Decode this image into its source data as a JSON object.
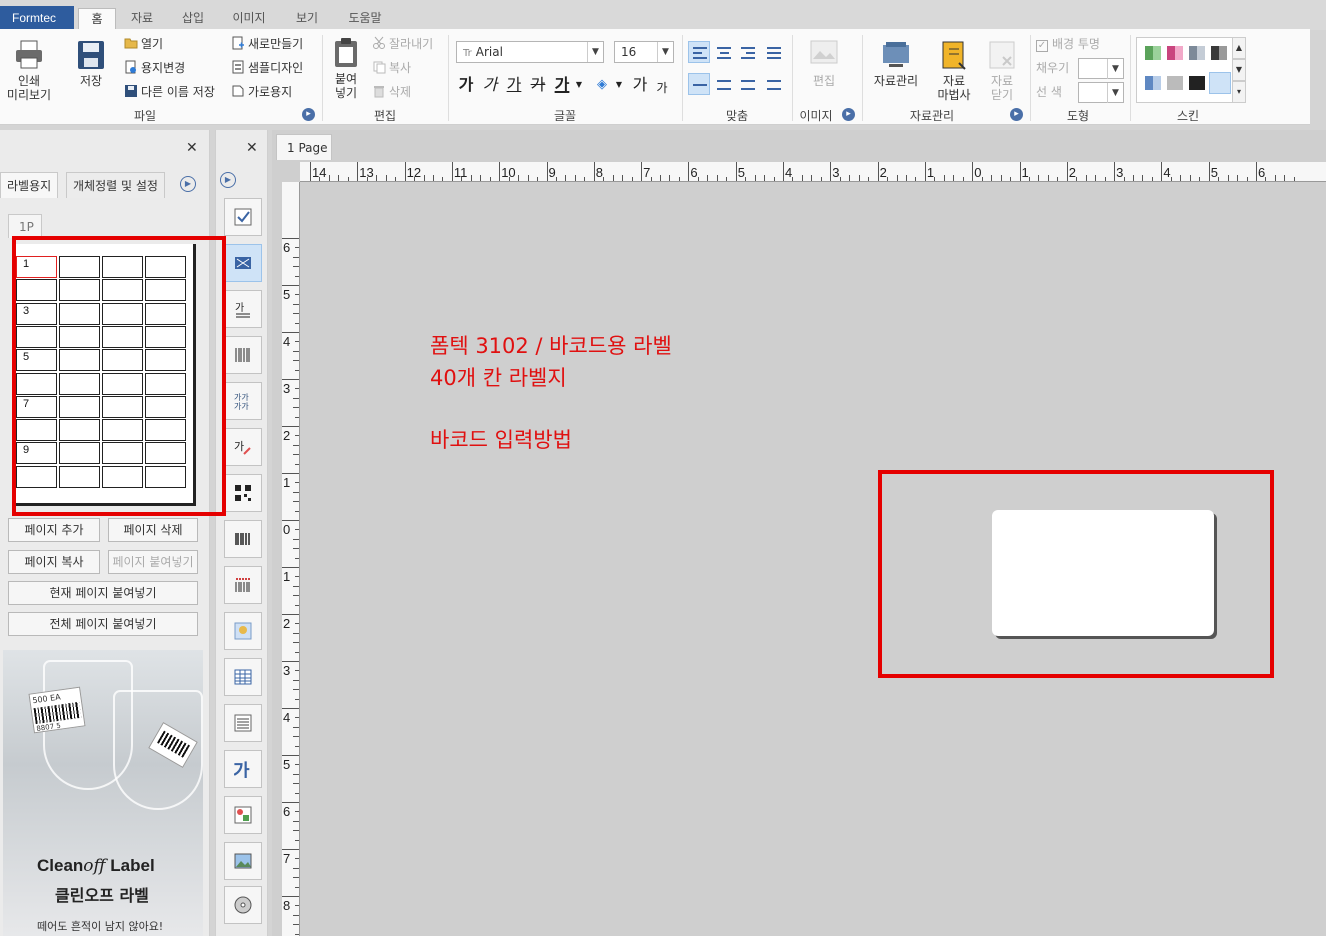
{
  "app": {
    "title": "Formtec"
  },
  "menu": {
    "tabs": [
      "홈",
      "자료",
      "삽입",
      "이미지",
      "보기",
      "도움말"
    ],
    "active": "홈"
  },
  "ribbon": {
    "file": {
      "print_preview": "인쇄\n미리보기",
      "save": "저장",
      "open": "열기",
      "change_paper": "용지변경",
      "save_as": "다른 이름 저장",
      "new": "새로만들기",
      "sample_design": "샘플디자인",
      "landscape": "가로용지",
      "group_label": "파일"
    },
    "edit": {
      "paste": "붙여\n넣기",
      "cut": "잘라내기",
      "copy": "복사",
      "delete": "삭제",
      "group_label": "편집"
    },
    "font": {
      "font_name": "Arial",
      "font_size": "16",
      "bold": "가",
      "italic": "가",
      "underline": "가",
      "strike": "가",
      "color": "가",
      "grow": "가",
      "shrink": "가",
      "group_label": "글꼴"
    },
    "align": {
      "group_label": "맞춤"
    },
    "image": {
      "edit": "편집",
      "group_label": "이미지"
    },
    "data": {
      "manage": "자료관리",
      "wizard": "자료\n마법사",
      "close": "자료\n닫기",
      "group_label": "자료관리"
    },
    "shape": {
      "transparent": "배경 투명",
      "fill": "채우기",
      "line_color": "선    색",
      "group_label": "도형"
    },
    "skin": {
      "group_label": "스킨"
    }
  },
  "left_panel": {
    "tabs": [
      "라벨용지",
      "개체정렬 및 설정"
    ],
    "active_tab": "라벨용지",
    "page_chip": "1P",
    "cell_numbers": [
      "1",
      "3",
      "5",
      "7",
      "9"
    ],
    "buttons": {
      "add_page": "페이지 추가",
      "delete_page": "페이지 삭제",
      "copy_page": "페이지 복사",
      "paste_page": "페이지 붙여넣기",
      "paste_current": "현재 페이지 붙여넣기",
      "paste_all": "전체 페이지 붙여넣기"
    },
    "ad": {
      "brand_en_1": "Clean",
      "brand_en_2": "off",
      "brand_en_3": " Label",
      "brand_ko": "클린오프 라벨",
      "tagline": "떼어도 흔적이 남지 않아요!",
      "sticker_text": "500 EA",
      "barcode_digits": "8807 5"
    }
  },
  "canvas": {
    "page_tab": "1 Page",
    "hruler_labels": [
      "14",
      "13",
      "12",
      "11",
      "10",
      "9",
      "8",
      "7",
      "6",
      "5",
      "4",
      "3",
      "2",
      "1",
      "0",
      "1",
      "2",
      "3",
      "4",
      "5",
      "6"
    ],
    "vruler_labels": [
      "6",
      "5",
      "4",
      "3",
      "2",
      "1",
      "0",
      "1",
      "2",
      "3",
      "4",
      "5",
      "6",
      "7",
      "8"
    ],
    "notes": [
      "폼텍 3102 / 바코드용 라벨",
      "40개 칸 라벨지",
      "바코드 입력방법"
    ]
  },
  "colors": {
    "accent": "#2e5c9e",
    "annotation_red": "#e50000"
  }
}
